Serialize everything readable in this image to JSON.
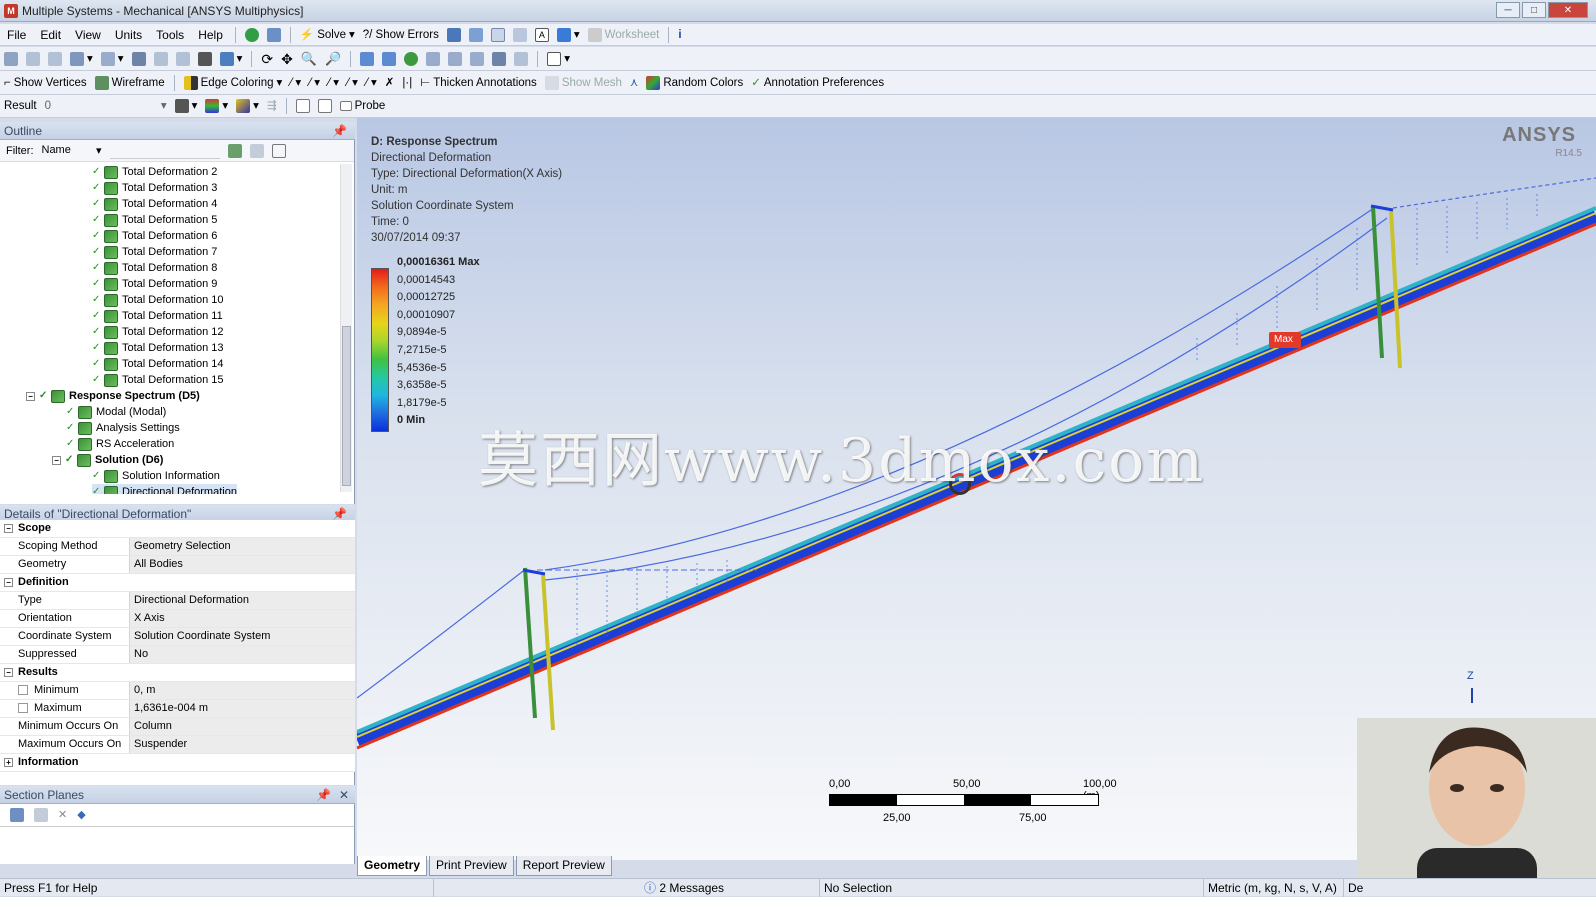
{
  "window": {
    "title": "Multiple Systems - Mechanical [ANSYS Multiphysics]",
    "app_icon": "M"
  },
  "menu": [
    "File",
    "Edit",
    "View",
    "Units",
    "Tools",
    "Help"
  ],
  "toolbar1": {
    "solve": "Solve",
    "show_errors": "?/ Show Errors",
    "worksheet": "Worksheet"
  },
  "toolbar3": {
    "show_vertices": "Show Vertices",
    "wireframe": "Wireframe",
    "edge_coloring": "Edge Coloring",
    "thicken": "Thicken Annotations",
    "show_mesh": "Show Mesh",
    "random_colors": "Random Colors",
    "annotation_prefs": "Annotation Preferences"
  },
  "toolbar4": {
    "result_label": "Result",
    "result_value": "0",
    "probe": "Probe"
  },
  "outline": {
    "title": "Outline",
    "filter_label": "Filter:",
    "filter_value": "Name",
    "items": [
      {
        "label": "Total Deformation 2",
        "indent": 3
      },
      {
        "label": "Total Deformation 3",
        "indent": 3
      },
      {
        "label": "Total Deformation 4",
        "indent": 3
      },
      {
        "label": "Total Deformation 5",
        "indent": 3
      },
      {
        "label": "Total Deformation 6",
        "indent": 3
      },
      {
        "label": "Total Deformation 7",
        "indent": 3
      },
      {
        "label": "Total Deformation 8",
        "indent": 3
      },
      {
        "label": "Total Deformation 9",
        "indent": 3
      },
      {
        "label": "Total Deformation 10",
        "indent": 3
      },
      {
        "label": "Total Deformation 11",
        "indent": 3
      },
      {
        "label": "Total Deformation 12",
        "indent": 3
      },
      {
        "label": "Total Deformation 13",
        "indent": 3
      },
      {
        "label": "Total Deformation 14",
        "indent": 3
      },
      {
        "label": "Total Deformation 15",
        "indent": 3
      },
      {
        "label": "Response Spectrum (D5)",
        "indent": 1,
        "bold": true,
        "expander": "−"
      },
      {
        "label": "Modal (Modal)",
        "indent": 2
      },
      {
        "label": "Analysis Settings",
        "indent": 2
      },
      {
        "label": "RS Acceleration",
        "indent": 2
      },
      {
        "label": "Solution (D6)",
        "indent": 2,
        "bold": true,
        "expander": "−"
      },
      {
        "label": "Solution Information",
        "indent": 3
      },
      {
        "label": "Directional Deformation",
        "indent": 3,
        "selected": true
      }
    ]
  },
  "details": {
    "title": "Details of \"Directional Deformation\"",
    "rows": [
      {
        "group": "Scope",
        "expander": "−"
      },
      {
        "key": "Scoping Method",
        "value": "Geometry Selection"
      },
      {
        "key": "Geometry",
        "value": "All Bodies"
      },
      {
        "group": "Definition",
        "expander": "−"
      },
      {
        "key": "Type",
        "value": "Directional Deformation"
      },
      {
        "key": "Orientation",
        "value": "X Axis"
      },
      {
        "key": "Coordinate System",
        "value": "Solution Coordinate System"
      },
      {
        "key": "Suppressed",
        "value": "No"
      },
      {
        "group": "Results",
        "expander": "−"
      },
      {
        "key": "Minimum",
        "value": "0, m",
        "checkbox": true
      },
      {
        "key": "Maximum",
        "value": "1,6361e-004 m",
        "checkbox": true
      },
      {
        "key": "Minimum Occurs On",
        "value": "Column"
      },
      {
        "key": "Maximum Occurs On",
        "value": "Suspender"
      },
      {
        "group": "Information",
        "expander": "+"
      }
    ]
  },
  "section_planes": {
    "title": "Section Planes"
  },
  "viewport": {
    "info_lines": [
      "D: Response Spectrum",
      "Directional Deformation",
      "Type: Directional Deformation(X Axis)",
      "Unit: m",
      "Solution Coordinate System",
      "Time: 0",
      "30/07/2014 09:37"
    ],
    "legend": [
      "0,00016361 Max",
      "0,00014543",
      "0,00012725",
      "0,00010907",
      "9,0894e-5",
      "7,2715e-5",
      "5,4536e-5",
      "3,6358e-5",
      "1,8179e-5",
      "0 Min"
    ],
    "legend_colors": [
      "#e31b1b",
      "#f26b1c",
      "#f5a623",
      "#e8d31a",
      "#a9d62b",
      "#3fc23f",
      "#25c9a0",
      "#1fb7e0",
      "#1f6fe0",
      "#0b2fd9"
    ],
    "brand": "ANSYS",
    "version": "R14.5",
    "max_tag": "Max",
    "axis_z": "Z",
    "scale_top": [
      "0,00",
      "50,00",
      "100,00 (m)"
    ],
    "scale_bottom": [
      "25,00",
      "75,00"
    ],
    "watermark": "莫西网www.3dmox.com"
  },
  "tabs": [
    "Geometry",
    "Print Preview",
    "Report Preview"
  ],
  "status": {
    "help": "Press F1 for Help",
    "messages": "2 Messages",
    "selection": "No Selection",
    "units": "Metric (m, kg, N, s, V, A)",
    "extra": "De"
  }
}
